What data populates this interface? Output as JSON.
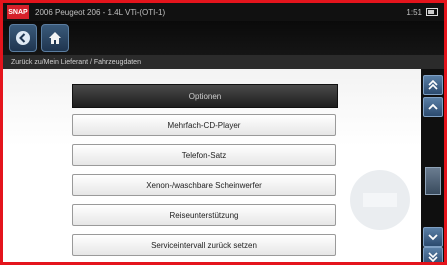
{
  "window": {
    "brand": "SNAP",
    "title": "2006 Peugeot 206 - 1.4L VTi-(OTI-1)",
    "time": "1:51"
  },
  "breadcrumb": "Zurück zu/Mein Lieferant / Fahrzeugdaten",
  "menu": {
    "header": "Optionen",
    "items": [
      {
        "label": "Mehrfach-CD-Player"
      },
      {
        "label": "Telefon-Satz"
      },
      {
        "label": "Xenon-/waschbare Scheinwerfer"
      },
      {
        "label": "Reiseunterstützung"
      },
      {
        "label": "Serviceintervall zurück setzen"
      }
    ]
  },
  "colors": {
    "frame": "#e4141c",
    "accent": "#3a5a7a"
  }
}
